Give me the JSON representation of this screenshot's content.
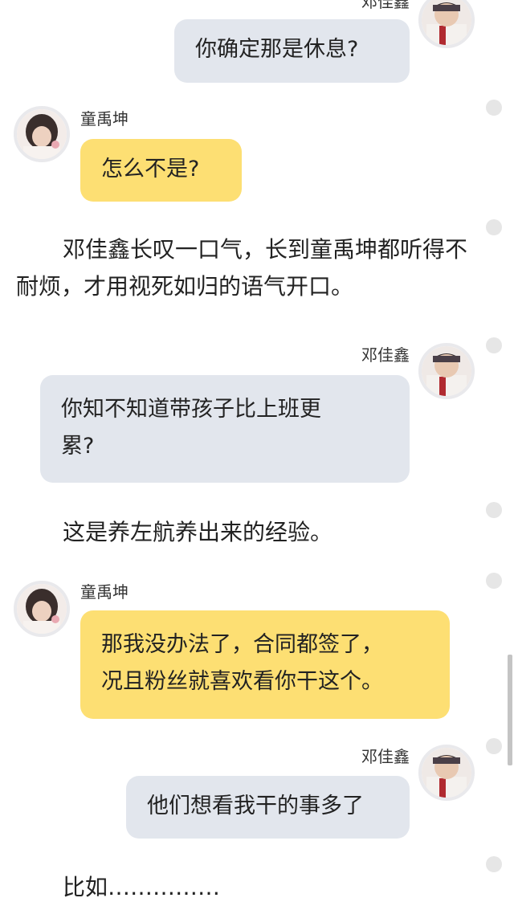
{
  "colors": {
    "bubble_gray": "#e2e6ed",
    "bubble_yellow": "#fddf73",
    "page_bg": "#ffffff"
  },
  "messages": [
    {
      "sender": "邓佳鑫",
      "text": "你确定那是休息?",
      "side": "right",
      "style": "gray"
    },
    {
      "sender": "童禹坤",
      "text": "怎么不是?",
      "side": "left",
      "style": "yellow"
    },
    {
      "narration": "邓佳鑫长叹一口气，长到童禹坤都听得不耐烦，才用视死如归的语气开口。"
    },
    {
      "sender": "邓佳鑫",
      "text_line1": "你知不知道带孩子比上班更",
      "text_line2": "累?",
      "side": "right",
      "style": "gray"
    },
    {
      "narration": "这是养左航养出来的经验。"
    },
    {
      "sender": "童禹坤",
      "text_line1": "那我没办法了，合同都签了，",
      "text_line2": "况且粉丝就喜欢看你干这个。",
      "side": "left",
      "style": "yellow"
    },
    {
      "sender": "邓佳鑫",
      "text": "他们想看我干的事多了",
      "side": "right",
      "style": "gray"
    },
    {
      "narration": "比如……………"
    }
  ],
  "icons": {
    "avatar_dengjiaxin": "avatar-dengjiaxin-icon",
    "avatar_tongyukun": "avatar-tongyukun-icon",
    "action_dot": "dot-icon"
  }
}
